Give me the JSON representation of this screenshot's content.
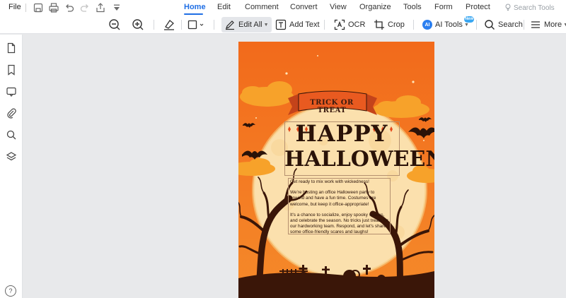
{
  "menu": {
    "file_label": "File",
    "tabs": [
      "Home",
      "Edit",
      "Comment",
      "Convert",
      "View",
      "Organize",
      "Tools",
      "Form",
      "Protect"
    ],
    "active_tab": "Home",
    "search_tools_label": "Search Tools"
  },
  "toolbar": {
    "edit_all_label": "Edit All",
    "add_text_label": "Add Text",
    "ocr_label": "OCR",
    "crop_label": "Crop",
    "ai_tools_label": "AI Tools",
    "ai_badge": "New",
    "search_label": "Search",
    "more_label": "More"
  },
  "document": {
    "banner_text": "TRICK OR TREAT",
    "headline_line1": "HAPPY",
    "headline_line2": "HALLOWEEN",
    "paragraphs": [
      "Get ready to mix work with wickedness!",
      "We're hosting an office Halloween party to unwind and have a fun time. Costumes are welcome, but keep it office-appropriate!",
      "It's a chance to socialize, enjoy spooky snacks, and celebrate the season. No tricks just treats for our hardworking team. Respond, and let's share some office-friendly scares and laughs!"
    ]
  },
  "colors": {
    "accent": "#1f6fe5",
    "page_orange": "#f2771f",
    "moon": "#fbe0ad",
    "silhouette": "#3a1608"
  },
  "icons": {
    "left_panel": [
      "page-icon",
      "bookmark-icon",
      "comment-icon",
      "attachment-icon",
      "search-icon",
      "layers-icon"
    ],
    "help": "?"
  }
}
